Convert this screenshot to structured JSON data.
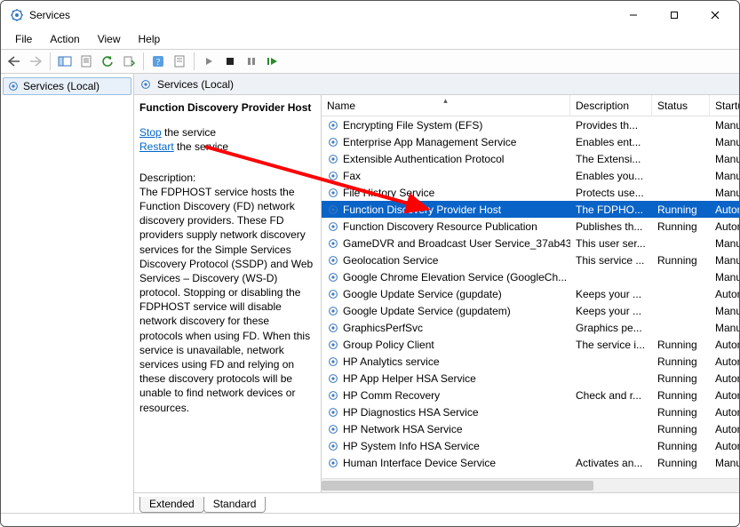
{
  "window": {
    "title": "Services"
  },
  "menu": {
    "file": "File",
    "action": "Action",
    "view": "View",
    "help": "Help"
  },
  "tree": {
    "root": "Services (Local)"
  },
  "content_header": "Services (Local)",
  "detail": {
    "service_name": "Function Discovery Provider Host",
    "stop_text": "Stop",
    "stop_suffix": " the service",
    "restart_text": "Restart",
    "restart_suffix": " the service",
    "desc_label": "Description:",
    "description": "The FDPHOST service hosts the Function Discovery (FD) network discovery providers. These FD providers supply network discovery services for the Simple Services Discovery Protocol (SSDP) and Web Services – Discovery (WS-D) protocol. Stopping or disabling the FDPHOST service will disable network discovery for these protocols when using FD. When this service is unavailable, network services using FD and relying on these discovery protocols will be unable to find network devices or resources."
  },
  "columns": {
    "name": "Name",
    "description": "Description",
    "status": "Status",
    "startup": "Startup Ty"
  },
  "services": [
    {
      "name": "Encrypting File System (EFS)",
      "desc": "Provides th...",
      "status": "",
      "startup": "Manual ("
    },
    {
      "name": "Enterprise App Management Service",
      "desc": "Enables ent...",
      "status": "",
      "startup": "Manual"
    },
    {
      "name": "Extensible Authentication Protocol",
      "desc": "The Extensi...",
      "status": "",
      "startup": "Manual"
    },
    {
      "name": "Fax",
      "desc": "Enables you...",
      "status": "",
      "startup": "Manual"
    },
    {
      "name": "File History Service",
      "desc": "Protects use...",
      "status": "",
      "startup": "Manual ("
    },
    {
      "name": "Function Discovery Provider Host",
      "desc": "The FDPHO...",
      "status": "Running",
      "startup": "Automat",
      "selected": true
    },
    {
      "name": "Function Discovery Resource Publication",
      "desc": "Publishes th...",
      "status": "Running",
      "startup": "Automat"
    },
    {
      "name": "GameDVR and Broadcast User Service_37ab43",
      "desc": "This user ser...",
      "status": "",
      "startup": "Manual"
    },
    {
      "name": "Geolocation Service",
      "desc": "This service ...",
      "status": "Running",
      "startup": "Manual ("
    },
    {
      "name": "Google Chrome Elevation Service (GoogleCh...",
      "desc": "",
      "status": "",
      "startup": "Manual"
    },
    {
      "name": "Google Update Service (gupdate)",
      "desc": "Keeps your ...",
      "status": "",
      "startup": "Automat"
    },
    {
      "name": "Google Update Service (gupdatem)",
      "desc": "Keeps your ...",
      "status": "",
      "startup": "Manual"
    },
    {
      "name": "GraphicsPerfSvc",
      "desc": "Graphics pe...",
      "status": "",
      "startup": "Manual ("
    },
    {
      "name": "Group Policy Client",
      "desc": "The service i...",
      "status": "Running",
      "startup": "Automat"
    },
    {
      "name": "HP Analytics service",
      "desc": "",
      "status": "Running",
      "startup": "Automat"
    },
    {
      "name": "HP App Helper HSA Service",
      "desc": "",
      "status": "Running",
      "startup": "Automat"
    },
    {
      "name": "HP Comm Recovery",
      "desc": "Check and r...",
      "status": "Running",
      "startup": "Automat"
    },
    {
      "name": "HP Diagnostics HSA Service",
      "desc": "",
      "status": "Running",
      "startup": "Automat"
    },
    {
      "name": "HP Network HSA Service",
      "desc": "",
      "status": "Running",
      "startup": "Automat"
    },
    {
      "name": "HP System Info HSA Service",
      "desc": "",
      "status": "Running",
      "startup": "Automat"
    },
    {
      "name": "Human Interface Device Service",
      "desc": "Activates an...",
      "status": "Running",
      "startup": "Manual ("
    }
  ],
  "tabs": {
    "extended": "Extended",
    "standard": "Standard"
  }
}
